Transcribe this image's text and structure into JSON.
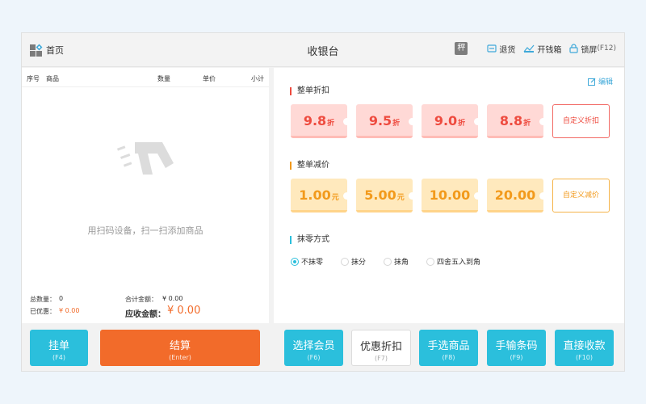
{
  "header": {
    "home_label": "首页",
    "title": "收银台",
    "scale_icon_text": "秤",
    "return_label": "退货",
    "cashbox_label": "开钱箱",
    "lock_label": "锁屏",
    "lock_shortcut": "(F12)"
  },
  "table": {
    "columns": [
      "序号",
      "商品",
      "数量",
      "单价",
      "小计"
    ],
    "empty_text": "用扫码设备，扫一扫添加商品"
  },
  "summary": {
    "total_qty_label": "总数量：",
    "total_qty_value": "0",
    "total_amount_label": "合计金额：",
    "total_amount_value": "¥ 0.00",
    "discounted_label": "已优惠：",
    "discounted_value": "¥ 0.00",
    "due_label": "应收金额：",
    "due_value": "¥ 0.00"
  },
  "discount": {
    "edit_label": "编辑",
    "whole_discount_title": "整单折扣",
    "discount_unit": "折",
    "discounts": [
      "9.8",
      "9.5",
      "9.0",
      "8.8"
    ],
    "custom_discount_label": "自定义折扣",
    "whole_reduce_title": "整单减价",
    "reduce_unit": "元",
    "reductions": [
      "1.00",
      "5.00",
      "10.00",
      "20.00"
    ],
    "custom_reduce_label": "自定义减价",
    "rounding_title": "抹零方式",
    "rounding_options": [
      "不抹零",
      "抹分",
      "抹角",
      "四舍五入到角"
    ],
    "rounding_selected": 0
  },
  "buttons": {
    "hold": {
      "label": "挂单",
      "key": "(F4)"
    },
    "checkout": {
      "label": "结算",
      "key": "(Enter)"
    },
    "member": {
      "label": "选择会员",
      "key": "(F6)"
    },
    "discount": {
      "label": "优惠折扣",
      "key": "(F7)"
    },
    "pick_goods": {
      "label": "手选商品",
      "key": "(F8)"
    },
    "barcode": {
      "label": "手输条码",
      "key": "(F9)"
    },
    "direct": {
      "label": "直接收款",
      "key": "(F10)"
    }
  },
  "colors": {
    "accent": "#2bbfdc",
    "orange": "#f26b2a",
    "discount_red": "#ee4b3f",
    "reduce_yellow": "#f29a1c"
  }
}
